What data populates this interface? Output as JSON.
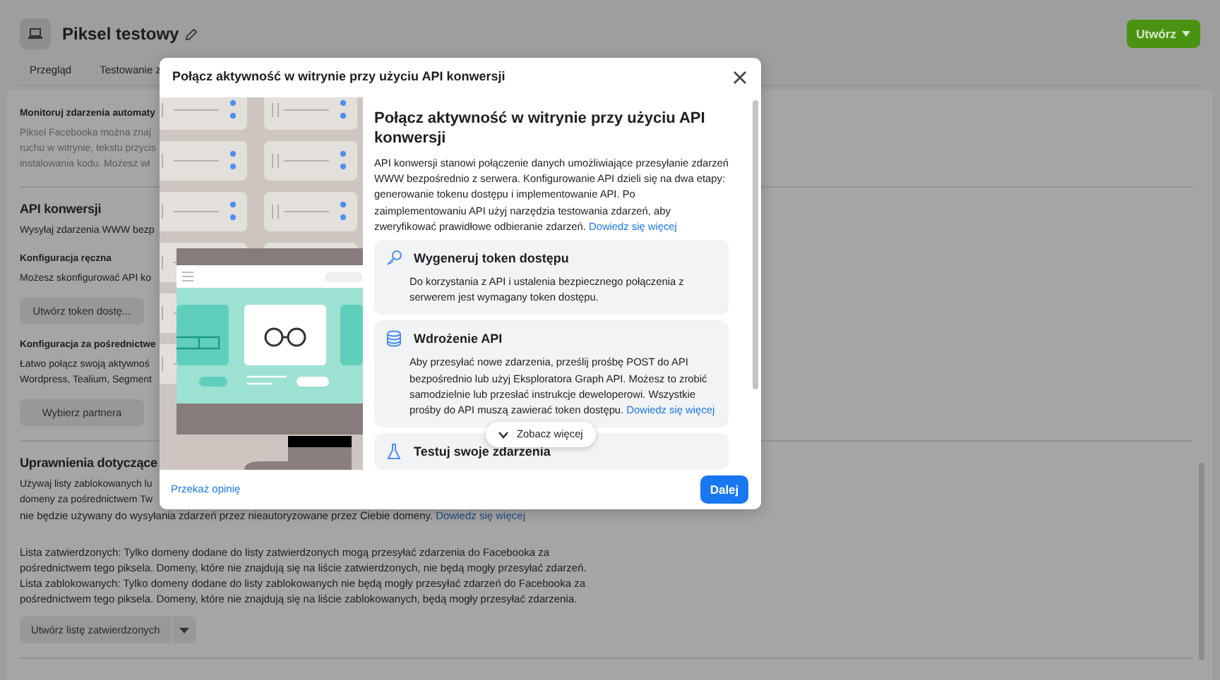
{
  "page": {
    "title": "Piksel testowy",
    "create_button": "Utwórz",
    "tabs": [
      {
        "label": "Przegląd"
      },
      {
        "label": "Testowanie z"
      }
    ],
    "blocks": [
      {
        "kind": "subheading",
        "text": "Monitoruj zdarzenia automaty"
      },
      {
        "kind": "muted",
        "lines": [
          "Piksel Facebooka można znaj",
          "ruchu w witrynie, tekstu przycis",
          "instalowania kodu. Możesz wł"
        ]
      },
      {
        "kind": "divider"
      },
      {
        "kind": "heading",
        "text": "API konwersji"
      },
      {
        "kind": "lines",
        "lines": [
          "Wysyłaj zdarzenia WWW bezp"
        ]
      },
      {
        "kind": "subheading",
        "text": "Konfiguracja ręczna"
      },
      {
        "kind": "lines",
        "lines": [
          "Możesz skonfigurować API ko"
        ]
      },
      {
        "kind": "button",
        "text": "Utwórz token dostę..."
      },
      {
        "kind": "subheading",
        "text": "Konfiguracja za pośrednictwe"
      },
      {
        "kind": "lines",
        "lines": [
          "Łatwo połącz swoją aktywnoś",
          "Wordpress, Tealium, Segment"
        ]
      },
      {
        "kind": "button",
        "text": "Wybierz partnera"
      },
      {
        "kind": "divider"
      },
      {
        "kind": "heading",
        "text": "Uprawnienia dotyczące"
      },
      {
        "kind": "lines",
        "lines": [
          "Używaj listy zablokowanych lu",
          "domeny za pośrednictwem Tw"
        ]
      },
      {
        "kind": "text",
        "text": "nie będzie używany do wysyłania zdarzeń przez nieautoryzowane przez Ciebie domeny.",
        "link": "Dowiedz się więcej"
      },
      {
        "kind": "paragraph",
        "text": "Lista zatwierdzonych: Tylko domeny dodane do listy zatwierdzonych mogą przesyłać zdarzenia do Facebooka za pośrednictwem tego piksela. Domeny, które nie znajdują się na liście zatwierdzonych, nie będą mogły przesyłać zdarzeń."
      },
      {
        "kind": "text",
        "text": "Lista zablokowanych: Tylko domeny dodane do listy zablokowanych nie będą mogły przesyłać zdarzeń do Facebooka za pośrednictwem tego piksela. Domeny, które nie znajdują się na liście zablokowanych, będą mogły przesyłać zdarzenia."
      },
      {
        "kind": "split_button",
        "text": "Utwórz listę zatwierdzonych"
      },
      {
        "kind": "divider"
      }
    ]
  },
  "modal": {
    "title": "Połącz aktywność w witrynie przy użyciu API konwersji",
    "heading": "Połącz aktywność w witrynie przy użyciu API konwersji",
    "intro": "API konwersji stanowi połączenie danych umożliwiające przesyłanie zdarzeń WWW bezpośrednio z serwera. Konfigurowanie API dzieli się na dwa etapy: generowanie tokenu dostępu i implementowanie API. Po zaimplementowaniu API użyj narzędzia testowania zdarzeń, aby zweryfikować prawidłowe odbieranie zdarzeń.",
    "intro_link": "Dowiedz się więcej",
    "steps": [
      {
        "kind": "key",
        "title": "Wygeneruj token dostępu",
        "text": "Do korzystania z API i ustalenia bezpiecznego połączenia z serwerem jest wymagany token dostępu."
      },
      {
        "kind": "database",
        "title": "Wdrożenie API",
        "text": "Aby przesyłać nowe zdarzenia, prześlij prośbę POST do API bezpośrednio lub użyj Eksploratora Graph API. Możesz to zrobić samodzielnie lub przesłać instrukcje deweloperowi. Wszystkie prośby do API muszą zawierać token dostępu.",
        "link": "Dowiedz się więcej"
      },
      {
        "kind": "flask",
        "title": "Testuj swoje zdarzenia"
      }
    ],
    "see_more": "Zobacz więcej",
    "feedback_link": "Przekaż opinię",
    "next_button": "Dalej"
  }
}
